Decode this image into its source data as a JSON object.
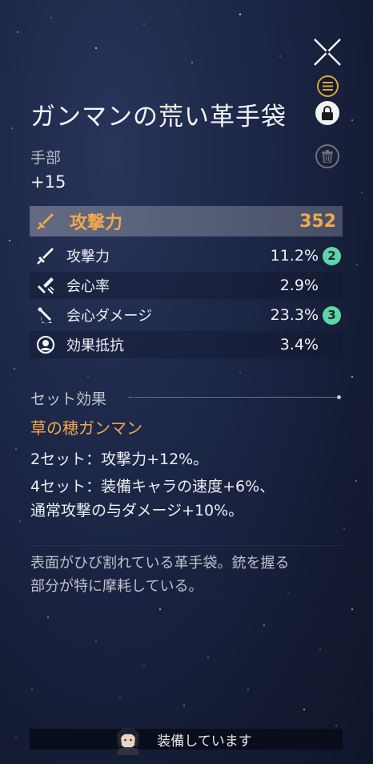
{
  "item": {
    "name": "ガンマンの荒い革手袋",
    "slot": "手部",
    "level": "+15"
  },
  "main_stat": {
    "name": "攻撃力",
    "value": "352",
    "icon": "sword-icon"
  },
  "sub_stats": [
    {
      "name": "攻撃力",
      "value": "11.2%",
      "rolls": "2",
      "icon": "sword-icon"
    },
    {
      "name": "会心率",
      "value": "2.9%",
      "rolls": "",
      "icon": "crit-rate-icon"
    },
    {
      "name": "会心ダメージ",
      "value": "23.3%",
      "rolls": "3",
      "icon": "crit-damage-icon"
    },
    {
      "name": "効果抵抗",
      "value": "3.4%",
      "rolls": "",
      "icon": "effect-res-icon"
    }
  ],
  "set": {
    "header": "セット効果",
    "name": "草の穂ガンマン",
    "effect_2": "2セット：攻撃力+12%。",
    "effect_4_line1": "4セット：装備キャラの速度+6%、",
    "effect_4_line2": "通常攻撃の与ダメージ+10%。"
  },
  "description_line1": "表面がひび割れている革手袋。銃を握る",
  "description_line2": "部分が特に摩耗している。",
  "equipped_label": "装備しています",
  "colors": {
    "accent": "#f0a84a",
    "badge": "#5ed5a8"
  }
}
